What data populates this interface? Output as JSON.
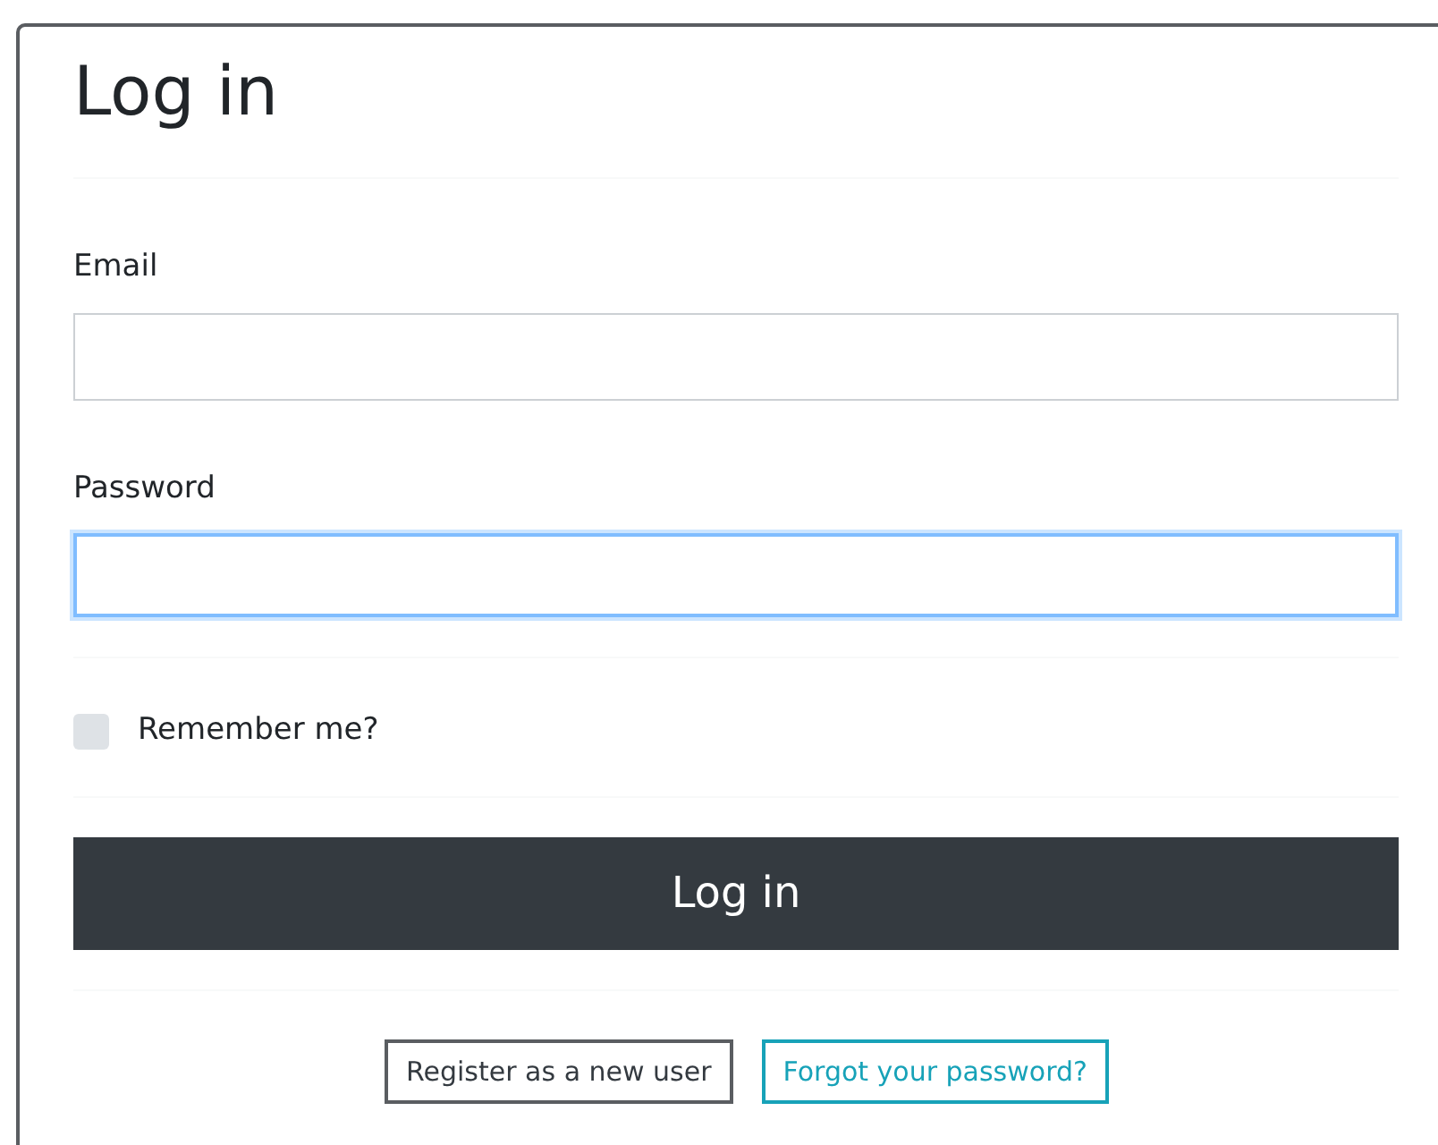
{
  "title": "Log in",
  "fields": [
    {
      "label": "Email",
      "focused": false
    },
    {
      "label": "Password",
      "focused": true
    }
  ],
  "remember": {
    "label": "Remember me?",
    "checked": false
  },
  "submit": "Log in",
  "links": [
    {
      "label": "Register as a new user",
      "kind": "dark"
    },
    {
      "label": "Forgot your password?",
      "kind": "info"
    }
  ]
}
